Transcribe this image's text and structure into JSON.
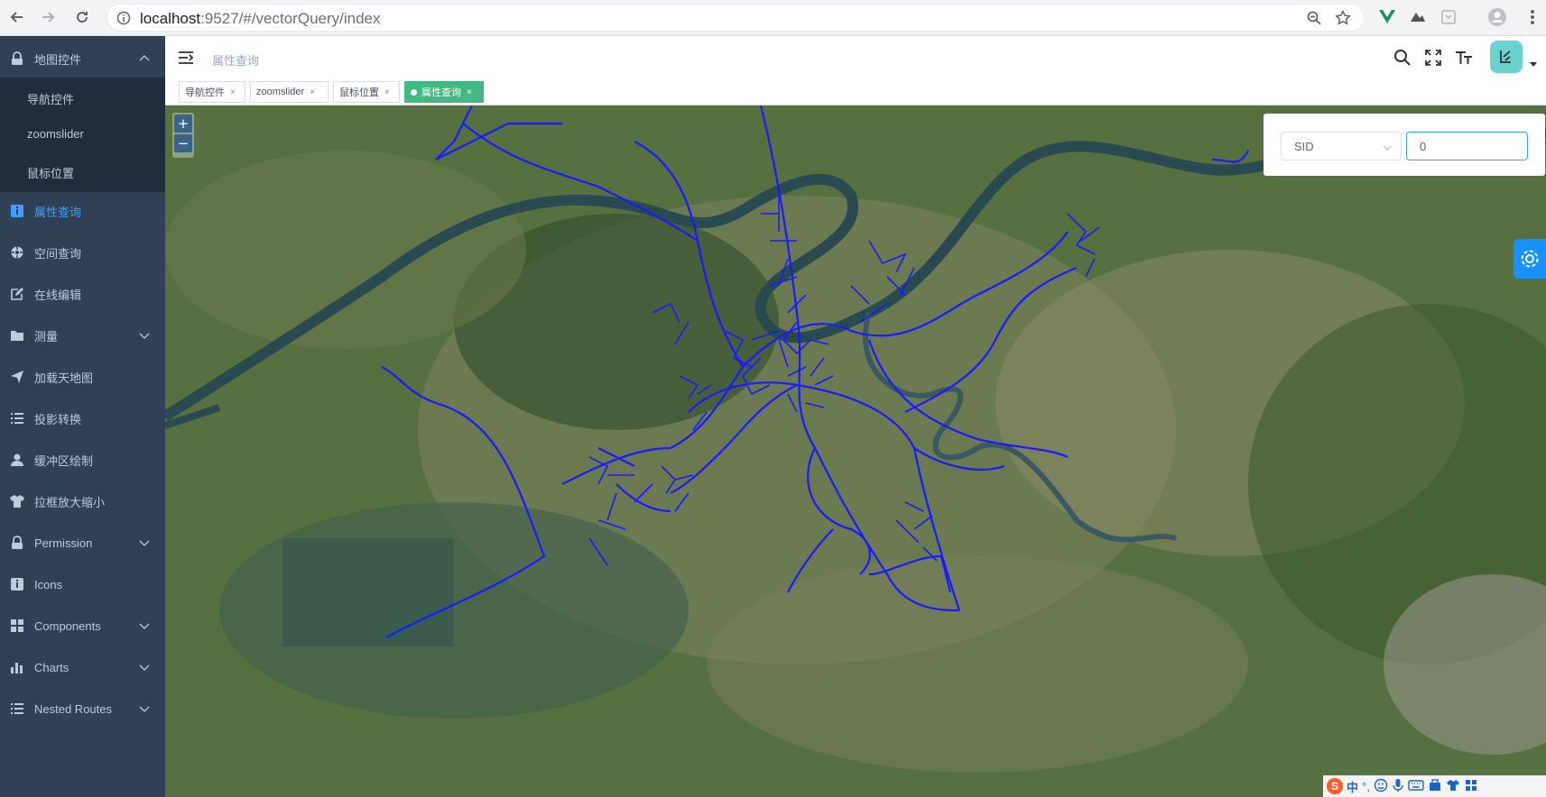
{
  "browser": {
    "url_host": "localhost",
    "url_path": ":9527/#/vectorQuery/index"
  },
  "sidebar": {
    "items": [
      {
        "label": "地图控件",
        "icon": "lock-icon",
        "expanded": true
      },
      {
        "label": "导航控件",
        "sub": true
      },
      {
        "label": "zoomslider",
        "sub": true
      },
      {
        "label": "鼠标位置",
        "sub": true
      },
      {
        "label": "属性查询",
        "icon": "info-icon",
        "active": true
      },
      {
        "label": "空间查询",
        "icon": "target-icon"
      },
      {
        "label": "在线编辑",
        "icon": "edit-icon"
      },
      {
        "label": "测量",
        "icon": "folder-icon",
        "chevron": true
      },
      {
        "label": "加载天地图",
        "icon": "send-icon"
      },
      {
        "label": "投影转换",
        "icon": "list-icon"
      },
      {
        "label": "缓冲区绘制",
        "icon": "user-icon"
      },
      {
        "label": "拉框放大缩小",
        "icon": "shirt-icon"
      },
      {
        "label": "Permission",
        "icon": "lock-icon",
        "chevron": true
      },
      {
        "label": "Icons",
        "icon": "info-icon"
      },
      {
        "label": "Components",
        "icon": "grid-icon",
        "chevron": true
      },
      {
        "label": "Charts",
        "icon": "chart-icon",
        "chevron": true
      },
      {
        "label": "Nested Routes",
        "icon": "list-icon",
        "chevron": true
      }
    ]
  },
  "navbar": {
    "breadcrumb": "属性查询"
  },
  "tags": [
    {
      "label": "导航控件",
      "close": "×"
    },
    {
      "label": "zoomslider",
      "close": "×"
    },
    {
      "label": "鼠标位置",
      "close": "×"
    },
    {
      "label": "属性查询",
      "close": "×",
      "active": true
    }
  ],
  "map": {
    "zoom_in": "+",
    "zoom_out": "−"
  },
  "query": {
    "field": "SID",
    "value": "0"
  },
  "taskbar": {
    "ime": "S",
    "lang": "中"
  },
  "colors": {
    "sidebar_bg": "#304156",
    "sidebar_sub_bg": "#1f2d3d",
    "active": "#409eff",
    "tag_active": "#42b983",
    "road": "#1a1aff"
  }
}
